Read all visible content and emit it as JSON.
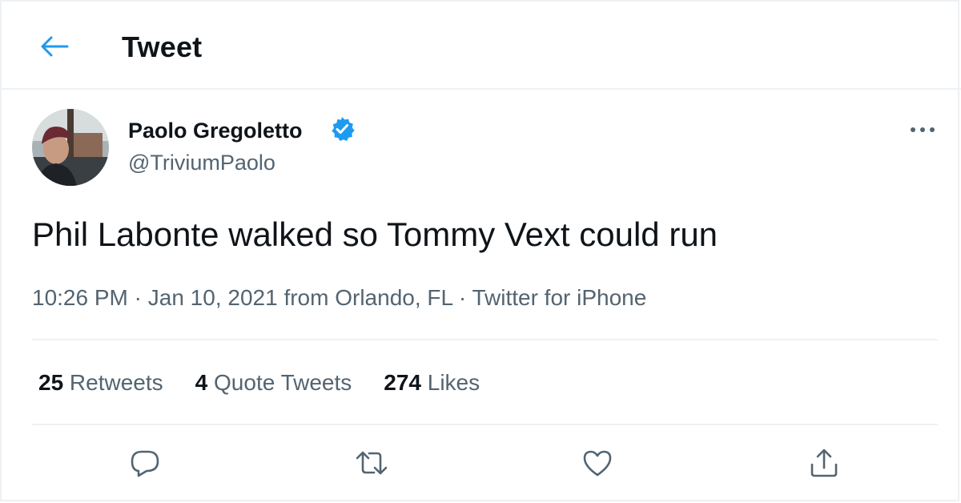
{
  "header": {
    "title": "Tweet",
    "back_icon": "arrow-left-icon",
    "accent_color": "#1d9bf0"
  },
  "author": {
    "name": "Paolo Gregoletto",
    "handle": "@TriviumPaolo",
    "verified": true,
    "verified_icon": "verified-badge-icon"
  },
  "tweet": {
    "text": "Phil Labonte walked so Tommy Vext could run",
    "time": "10:26 PM",
    "separator": " · ",
    "date_location": "Jan 10, 2021 from Orlando, FL",
    "source": "Twitter for iPhone"
  },
  "stats": {
    "retweets_count": "25",
    "retweets_label": " Retweets",
    "quotes_count": "4",
    "quotes_label": " Quote Tweets",
    "likes_count": "274",
    "likes_label": " Likes"
  },
  "actions": [
    {
      "name": "reply",
      "icon": "reply-icon"
    },
    {
      "name": "retweet",
      "icon": "retweet-icon"
    },
    {
      "name": "like",
      "icon": "heart-icon"
    },
    {
      "name": "share",
      "icon": "share-icon"
    }
  ],
  "colors": {
    "text_primary": "#0f1419",
    "text_secondary": "#536471",
    "divider": "#eef1f3",
    "verified": "#1d9bf0"
  }
}
